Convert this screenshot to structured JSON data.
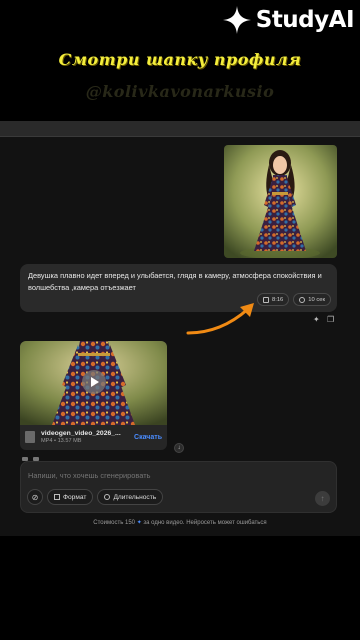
{
  "logo": {
    "text": "StudyAI"
  },
  "banner": {
    "title": "Смотри шапку профиля",
    "handle": "@kolivkavonarkusio"
  },
  "chat": {
    "prompt": "Девушка плавно идет вперед и улыбается, глядя в камеру, атмосфера спокойствия и волшебства ,камера отъезжает",
    "ratio": "8:16",
    "duration": "10 сек"
  },
  "video": {
    "file_name": "videogen_video_2026_...",
    "file_meta": "MP4 • 13.57 MB",
    "download_label": "Скачать"
  },
  "composer": {
    "placeholder": "Напиши, что хочешь сгенерировать",
    "format_label": "Формат",
    "duration_label": "Длительность"
  },
  "footer": {
    "cost_prefix": "Стоимость 150",
    "cost_suffix": "за одно видео. Нейросеть может ошибаться"
  },
  "colors": {
    "accent": "#4a8cff",
    "banner": "#f4ee3c",
    "arrow": "#f08a14"
  }
}
